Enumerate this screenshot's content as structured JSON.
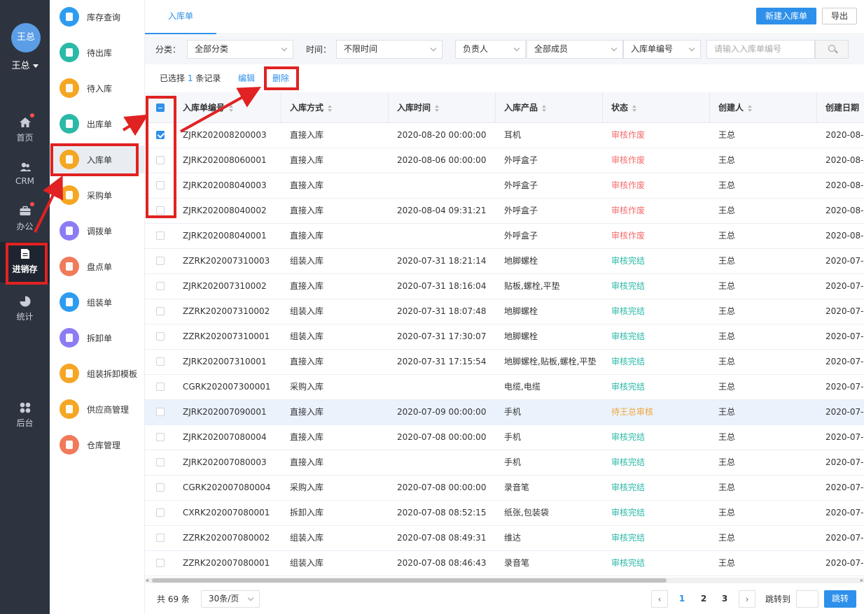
{
  "user": {
    "avatar_text": "王总",
    "name": "王总"
  },
  "rail": [
    {
      "key": "home",
      "label": "首页",
      "icon": "home-icon",
      "dot": true
    },
    {
      "key": "crm",
      "label": "CRM",
      "icon": "users-icon",
      "dot": false
    },
    {
      "key": "office",
      "label": "办公",
      "icon": "briefcase-icon",
      "dot": true
    },
    {
      "key": "inventory",
      "label": "进销存",
      "icon": "document-icon",
      "dot": false,
      "active": true
    },
    {
      "key": "stats",
      "label": "统计",
      "icon": "pie-chart-icon",
      "dot": false
    },
    {
      "key": "backend",
      "label": "后台",
      "icon": "grid-icon",
      "dot": false
    }
  ],
  "submenu": [
    {
      "label": "库存查询",
      "color": "#2d9cf0"
    },
    {
      "label": "待出库",
      "color": "#2bb9a7"
    },
    {
      "label": "待入库",
      "color": "#f5a623"
    },
    {
      "label": "出库单",
      "color": "#2bb9a7"
    },
    {
      "label": "入库单",
      "color": "#f5a623",
      "active": true
    },
    {
      "label": "采购单",
      "color": "#f5a623"
    },
    {
      "label": "调拨单",
      "color": "#8b7cf6"
    },
    {
      "label": "盘点单",
      "color": "#f07a5a"
    },
    {
      "label": "组装单",
      "color": "#2d9cf0"
    },
    {
      "label": "拆卸单",
      "color": "#8b7cf6"
    },
    {
      "label": "组装拆卸模板",
      "color": "#f5a623"
    },
    {
      "label": "供应商管理",
      "color": "#f5a623"
    },
    {
      "label": "仓库管理",
      "color": "#f07a5a"
    }
  ],
  "header": {
    "tab": "入库单",
    "new_button": "新建入库单",
    "export_button": "导出"
  },
  "filters": {
    "category_label": "分类：",
    "category_value": "全部分类",
    "time_label": "时间：",
    "time_value": "不限时间",
    "owner_value": "负责人",
    "members_value": "全部成员",
    "number_type_value": "入库单编号",
    "search_placeholder": "请输入入库单编号"
  },
  "actions": {
    "selected_prefix": "已选择",
    "selected_count": "1",
    "selected_suffix": "条记录",
    "edit": "编辑",
    "delete": "删除"
  },
  "table": {
    "columns": [
      "入库单编号",
      "入库方式",
      "入库时间",
      "入库产品",
      "状态",
      "创建人",
      "创建日期"
    ],
    "rows": [
      {
        "id": "ZJRK202008200003",
        "method": "直接入库",
        "time": "2020-08-20 00:00:00",
        "product": "耳机",
        "status": "审核作废",
        "status_type": "void",
        "creator": "王总",
        "date": "2020-08-",
        "checked": true
      },
      {
        "id": "ZJRK202008060001",
        "method": "直接入库",
        "time": "2020-08-06 00:00:00",
        "product": "外呼盒子",
        "status": "审核作废",
        "status_type": "void",
        "creator": "王总",
        "date": "2020-08-"
      },
      {
        "id": "ZJRK202008040003",
        "method": "直接入库",
        "time": "",
        "product": "外呼盒子",
        "status": "审核作废",
        "status_type": "void",
        "creator": "王总",
        "date": "2020-08-"
      },
      {
        "id": "ZJRK202008040002",
        "method": "直接入库",
        "time": "2020-08-04 09:31:21",
        "product": "外呼盒子",
        "status": "审核作废",
        "status_type": "void",
        "creator": "王总",
        "date": "2020-08-"
      },
      {
        "id": "ZJRK202008040001",
        "method": "直接入库",
        "time": "",
        "product": "外呼盒子",
        "status": "审核作废",
        "status_type": "void",
        "creator": "王总",
        "date": "2020-08-"
      },
      {
        "id": "ZZRK202007310003",
        "method": "组装入库",
        "time": "2020-07-31 18:21:14",
        "product": "地脚螺栓",
        "status": "审核完结",
        "status_type": "done",
        "creator": "王总",
        "date": "2020-07-"
      },
      {
        "id": "ZJRK202007310002",
        "method": "直接入库",
        "time": "2020-07-31 18:16:04",
        "product": "贴板,螺栓,平垫",
        "status": "审核完结",
        "status_type": "done",
        "creator": "王总",
        "date": "2020-07-"
      },
      {
        "id": "ZZRK202007310002",
        "method": "组装入库",
        "time": "2020-07-31 18:07:48",
        "product": "地脚螺栓",
        "status": "审核完结",
        "status_type": "done",
        "creator": "王总",
        "date": "2020-07-"
      },
      {
        "id": "ZZRK202007310001",
        "method": "组装入库",
        "time": "2020-07-31 17:30:07",
        "product": "地脚螺栓",
        "status": "审核完结",
        "status_type": "done",
        "creator": "王总",
        "date": "2020-07-"
      },
      {
        "id": "ZJRK202007310001",
        "method": "直接入库",
        "time": "2020-07-31 17:15:54",
        "product": "地脚螺栓,贴板,螺栓,平垫",
        "status": "审核完结",
        "status_type": "done",
        "creator": "王总",
        "date": "2020-07-"
      },
      {
        "id": "CGRK202007300001",
        "method": "采购入库",
        "time": "",
        "product": "电缆,电缆",
        "status": "审核完结",
        "status_type": "done",
        "creator": "王总",
        "date": "2020-07-"
      },
      {
        "id": "ZJRK202007090001",
        "method": "直接入库",
        "time": "2020-07-09 00:00:00",
        "product": "手机",
        "status": "待王总审核",
        "status_type": "pend",
        "creator": "王总",
        "date": "2020-07-",
        "hover": true
      },
      {
        "id": "ZJRK202007080004",
        "method": "直接入库",
        "time": "2020-07-08 00:00:00",
        "product": "手机",
        "status": "审核完结",
        "status_type": "done",
        "creator": "王总",
        "date": "2020-07-"
      },
      {
        "id": "ZJRK202007080003",
        "method": "直接入库",
        "time": "",
        "product": "手机",
        "status": "审核完结",
        "status_type": "done",
        "creator": "王总",
        "date": "2020-07-"
      },
      {
        "id": "CGRK202007080004",
        "method": "采购入库",
        "time": "2020-07-08 00:00:00",
        "product": "录音笔",
        "status": "审核完结",
        "status_type": "done",
        "creator": "王总",
        "date": "2020-07-"
      },
      {
        "id": "CXRK202007080001",
        "method": "拆卸入库",
        "time": "2020-07-08 08:52:15",
        "product": "纸张,包装袋",
        "status": "审核完结",
        "status_type": "done",
        "creator": "王总",
        "date": "2020-07-"
      },
      {
        "id": "ZZRK202007080002",
        "method": "组装入库",
        "time": "2020-07-08 08:49:31",
        "product": "维达",
        "status": "审核完结",
        "status_type": "done",
        "creator": "王总",
        "date": "2020-07-"
      },
      {
        "id": "ZZRK202007080001",
        "method": "组装入库",
        "time": "2020-07-08 08:46:43",
        "product": "录音笔",
        "status": "审核完结",
        "status_type": "done",
        "creator": "王总",
        "date": "2020-07-"
      }
    ]
  },
  "pager": {
    "total": "共 69 条",
    "page_size": "30条/页",
    "pages": [
      "1",
      "2",
      "3"
    ],
    "current": "1",
    "prev": "‹",
    "next": "›",
    "jump_label": "跳转到",
    "jump_button": "跳转"
  },
  "colors": {
    "primary": "#2e90ea",
    "void": "#f56c6c",
    "done": "#2bb9a7",
    "pending": "#f0a43a",
    "annotation": "#e02222",
    "rail_bg": "#2d3440"
  }
}
